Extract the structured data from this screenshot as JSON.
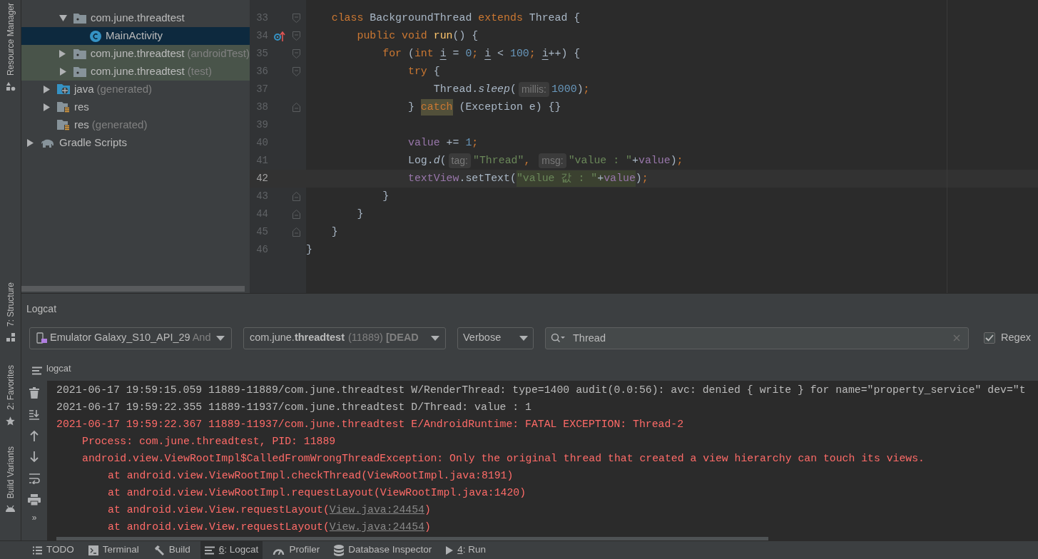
{
  "side_strip": [
    {
      "label": "Resource Manager",
      "kind": "resource"
    },
    {
      "label": "7: Structure",
      "kind": "structure"
    },
    {
      "label": "2: Favorites",
      "kind": "favorites"
    },
    {
      "label": "Build Variants",
      "kind": "variants"
    }
  ],
  "project_tree": {
    "source_packages": [
      {
        "label": "com.june.threadtest",
        "kind": "package",
        "expanded": true,
        "selected": false,
        "test_source": false,
        "children": [
          {
            "label": "MainActivity",
            "kind": "class",
            "selected": true,
            "test_source": false
          }
        ]
      },
      {
        "label": "com.june.threadtest",
        "suffix": "(androidTest)",
        "kind": "package",
        "expanded": false,
        "selected": false,
        "test_source": true
      },
      {
        "label": "com.june.threadtest",
        "suffix": "(test)",
        "kind": "package",
        "expanded": false,
        "selected": false,
        "test_source": true
      }
    ],
    "module_children": [
      {
        "label": "java",
        "suffix": "(generated)",
        "kind": "generated",
        "expanded": false,
        "selected": false,
        "test_source": false
      },
      {
        "label": "res",
        "kind": "res",
        "expanded": false,
        "selected": false,
        "test_source": false
      },
      {
        "label": "res",
        "suffix": "(generated)",
        "kind": "res",
        "selected": false,
        "test_source": false
      }
    ],
    "root_items": [
      {
        "label": "Gradle Scripts",
        "kind": "gradle",
        "expanded": false,
        "selected": false,
        "test_source": false
      }
    ]
  },
  "editor": {
    "lines": [
      {
        "number": "33",
        "current": false,
        "override": false,
        "kind": "fold_start",
        "tokens": [
          {
            "text": "    class",
            "kind": "keyword"
          },
          {
            "text": " BackgroundThread ",
            "kind": "plain"
          },
          {
            "text": "extends",
            "kind": "keyword"
          },
          {
            "text": " Thread {",
            "kind": "plain"
          }
        ]
      },
      {
        "number": "34",
        "current": false,
        "override": true,
        "kind": "fold_start",
        "tokens": [
          {
            "text": "        public void",
            "kind": "keyword"
          },
          {
            "text": " run",
            "kind": "method"
          },
          {
            "text": "() {",
            "kind": "plain"
          }
        ]
      },
      {
        "number": "35",
        "current": false,
        "override": false,
        "kind": "fold_start",
        "tokens": [
          {
            "text": "            for",
            "kind": "keyword"
          },
          {
            "text": " (",
            "kind": "plain"
          },
          {
            "text": "int ",
            "kind": "keyword"
          },
          {
            "text": "i",
            "kind": "variable"
          },
          {
            "text": " = ",
            "kind": "plain"
          },
          {
            "text": "0",
            "kind": "number"
          },
          {
            "text": "; ",
            "kind": "keyword"
          },
          {
            "text": "i",
            "kind": "variable"
          },
          {
            "text": " < ",
            "kind": "plain"
          },
          {
            "text": "100",
            "kind": "number"
          },
          {
            "text": "; ",
            "kind": "keyword"
          },
          {
            "text": "i",
            "kind": "variable"
          },
          {
            "text": "++) {",
            "kind": "plain"
          }
        ]
      },
      {
        "number": "36",
        "current": false,
        "override": false,
        "kind": "fold_start",
        "tokens": [
          {
            "text": "                try",
            "kind": "keyword"
          },
          {
            "text": " {",
            "kind": "plain"
          }
        ]
      },
      {
        "number": "37",
        "current": false,
        "override": false,
        "kind": "plain",
        "tokens": [
          {
            "text": "                    Thread.",
            "kind": "plain"
          },
          {
            "text": "sleep",
            "kind": "italic"
          },
          {
            "text": "(",
            "kind": "plain"
          },
          {
            "text": "millis:",
            "kind": "hint"
          },
          {
            "text": "1000",
            "kind": "number"
          },
          {
            "text": ")",
            "kind": "plain"
          },
          {
            "text": ";",
            "kind": "keyword"
          }
        ]
      },
      {
        "number": "38",
        "current": false,
        "override": false,
        "kind": "fold_end",
        "tokens": [
          {
            "text": "                } ",
            "kind": "plain"
          },
          {
            "text": "catch",
            "kind": "keyword_marked"
          },
          {
            "text": " (Exception e) {}",
            "kind": "plain"
          }
        ]
      },
      {
        "number": "39",
        "current": false,
        "override": false,
        "kind": "plain"
      },
      {
        "number": "40",
        "current": false,
        "override": false,
        "kind": "plain",
        "tokens": [
          {
            "text": "                value",
            "kind": "field"
          },
          {
            "text": " += ",
            "kind": "plain"
          },
          {
            "text": "1",
            "kind": "number"
          },
          {
            "text": ";",
            "kind": "keyword"
          }
        ]
      },
      {
        "number": "41",
        "current": false,
        "override": false,
        "kind": "plain",
        "tokens": [
          {
            "text": "                Log.",
            "kind": "plain"
          },
          {
            "text": "d",
            "kind": "italic"
          },
          {
            "text": "(",
            "kind": "plain"
          },
          {
            "text": "tag:",
            "kind": "hint"
          },
          {
            "text": "\"Thread\"",
            "kind": "string"
          },
          {
            "text": ", ",
            "kind": "keyword"
          },
          {
            "text": "msg:",
            "kind": "hint"
          },
          {
            "text": "\"value : \"",
            "kind": "string"
          },
          {
            "text": "+",
            "kind": "plain"
          },
          {
            "text": "value",
            "kind": "field"
          },
          {
            "text": ")",
            "kind": "plain"
          },
          {
            "text": ";",
            "kind": "keyword"
          }
        ]
      },
      {
        "number": "42",
        "current": true,
        "override": false,
        "kind": "plain",
        "tokens": [
          {
            "text": "                textView",
            "kind": "field"
          },
          {
            "text": ".setText(",
            "kind": "plain"
          },
          {
            "text": "\"value 값 : \"",
            "kind": "string_marked"
          },
          {
            "text": "+",
            "kind": "plain_marked"
          },
          {
            "text": "value",
            "kind": "field_marked"
          },
          {
            "text": ")",
            "kind": "plain"
          },
          {
            "text": ";",
            "kind": "keyword"
          }
        ]
      },
      {
        "number": "43",
        "current": false,
        "override": false,
        "kind": "fold_end",
        "tokens": [
          {
            "text": "            }",
            "kind": "plain"
          }
        ]
      },
      {
        "number": "44",
        "current": false,
        "override": false,
        "kind": "fold_end",
        "tokens": [
          {
            "text": "        }",
            "kind": "plain"
          }
        ]
      },
      {
        "number": "45",
        "current": false,
        "override": false,
        "kind": "fold_end",
        "tokens": [
          {
            "text": "    }",
            "kind": "plain"
          }
        ]
      },
      {
        "number": "46",
        "current": false,
        "override": false,
        "kind": "plain",
        "tokens": [
          {
            "text": "}",
            "kind": "plain"
          }
        ]
      }
    ]
  },
  "logcat": {
    "title": "Logcat",
    "device": {
      "value": "Emulator Galaxy_S10_API_29",
      "suffix": "And"
    },
    "process": {
      "value": "com.june.**threadtest**",
      "suffix": "(11889) **[DEAD**"
    },
    "level_filter": {
      "value": "Verbose"
    },
    "search": {
      "value": "Thread"
    },
    "regex": {
      "label": "Regex",
      "checked": true
    },
    "tab": {
      "label": "logcat"
    },
    "more_label": "»",
    "lines": [
      {
        "kind": "entry",
        "text": "2021-06-17 19:59:15.059 11889-11889/com.june.threadtest W/RenderThread: type=1400 audit(0.0:56): avc: denied { write } for name=\"property_service\" dev=\"t"
      },
      {
        "kind": "entry",
        "text": "2021-06-17 19:59:22.355 11889-11937/com.june.threadtest D/Thread: value : 1"
      },
      {
        "kind": "error_entry",
        "text": "2021-06-17 19:59:22.367 11889-11937/com.june.threadtest E/AndroidRuntime: FATAL EXCEPTION: Thread-2"
      },
      {
        "kind": "error_detail",
        "text": "Process: com.june.threadtest, PID: 11889"
      },
      {
        "kind": "error_detail",
        "text": "android.view.ViewRootImpl$CalledFromWrongThreadException: Only the original thread that created a view hierarchy can touch its views."
      },
      {
        "kind": "error_frame",
        "text": "at android.view.ViewRootImpl.checkThread(ViewRootImpl.java:8191)"
      },
      {
        "kind": "error_frame",
        "text": "at android.view.ViewRootImpl.requestLayout(ViewRootImpl.java:1420)"
      },
      {
        "kind": "error_frame",
        "text": "at android.view.View.requestLayout(",
        "link": "View.java:24454",
        "tail": ")"
      },
      {
        "kind": "error_frame",
        "text": "at android.view.View.requestLayout(",
        "link": "View.java:24454",
        "tail": ")"
      }
    ]
  },
  "bottom_tabs": [
    {
      "label": "TODO",
      "kind": "list",
      "selected": false,
      "mnemonic": false
    },
    {
      "label": "Terminal",
      "kind": "terminal",
      "selected": false,
      "mnemonic": false
    },
    {
      "label": "Build",
      "kind": "hammer",
      "selected": false,
      "mnemonic": false
    },
    {
      "label": "6: Logcat",
      "kind": "lines",
      "selected": true,
      "mnemonic": true
    },
    {
      "label": "Profiler",
      "kind": "gauge",
      "selected": false,
      "mnemonic": false
    },
    {
      "label": "Database Inspector",
      "kind": "database",
      "selected": false,
      "mnemonic": false
    },
    {
      "label": "4: Run",
      "kind": "play",
      "selected": false,
      "mnemonic": true
    }
  ]
}
